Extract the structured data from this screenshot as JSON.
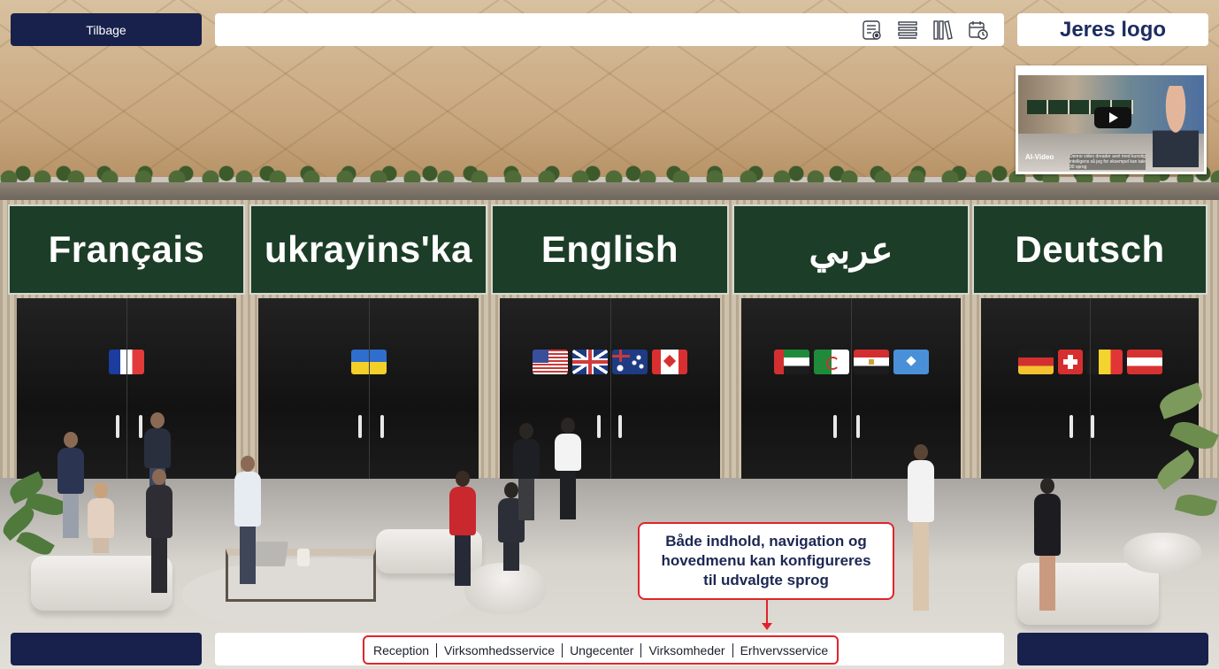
{
  "header": {
    "back_label": "Tilbage",
    "logo_text": "Jeres logo",
    "icons": [
      "list-view-icon",
      "menu-list-icon",
      "library-icon",
      "calendar-clock-icon"
    ]
  },
  "booths": [
    {
      "label": "Français",
      "flags": [
        "flag-fr"
      ]
    },
    {
      "label": "ukrayins'ka",
      "flags": [
        "flag-ua"
      ]
    },
    {
      "label": "English",
      "flags": [
        "flag-us",
        "flag-uk",
        "flag-au",
        "flag-ca"
      ]
    },
    {
      "label": "عربي",
      "flags": [
        "flag-ae",
        "flag-dz",
        "flag-eg",
        "flag-so"
      ]
    },
    {
      "label": "Deutsch",
      "flags": [
        "flag-de",
        "flag-ch",
        "flag-be",
        "flag-at"
      ]
    }
  ],
  "video": {
    "brand": "AI-Video",
    "caption": "Denne video dreader avet med kunstig intelligens så jeg for eksempel kan tale 30 sprog"
  },
  "callout": {
    "text": "Både indhold, navigation og\nhovedmenu kan konfigureres\ntil udvalgte sprog"
  },
  "bottom_menu": {
    "items": [
      "Reception",
      "Virksomhedsservice",
      "Ungecenter",
      "Virksomheder",
      "Erhvervsservice"
    ]
  },
  "colors": {
    "nav_button": "#17214b",
    "sign_green": "#1c3d27",
    "highlight_red": "#e0242c",
    "logo_text": "#1c2c5e"
  }
}
